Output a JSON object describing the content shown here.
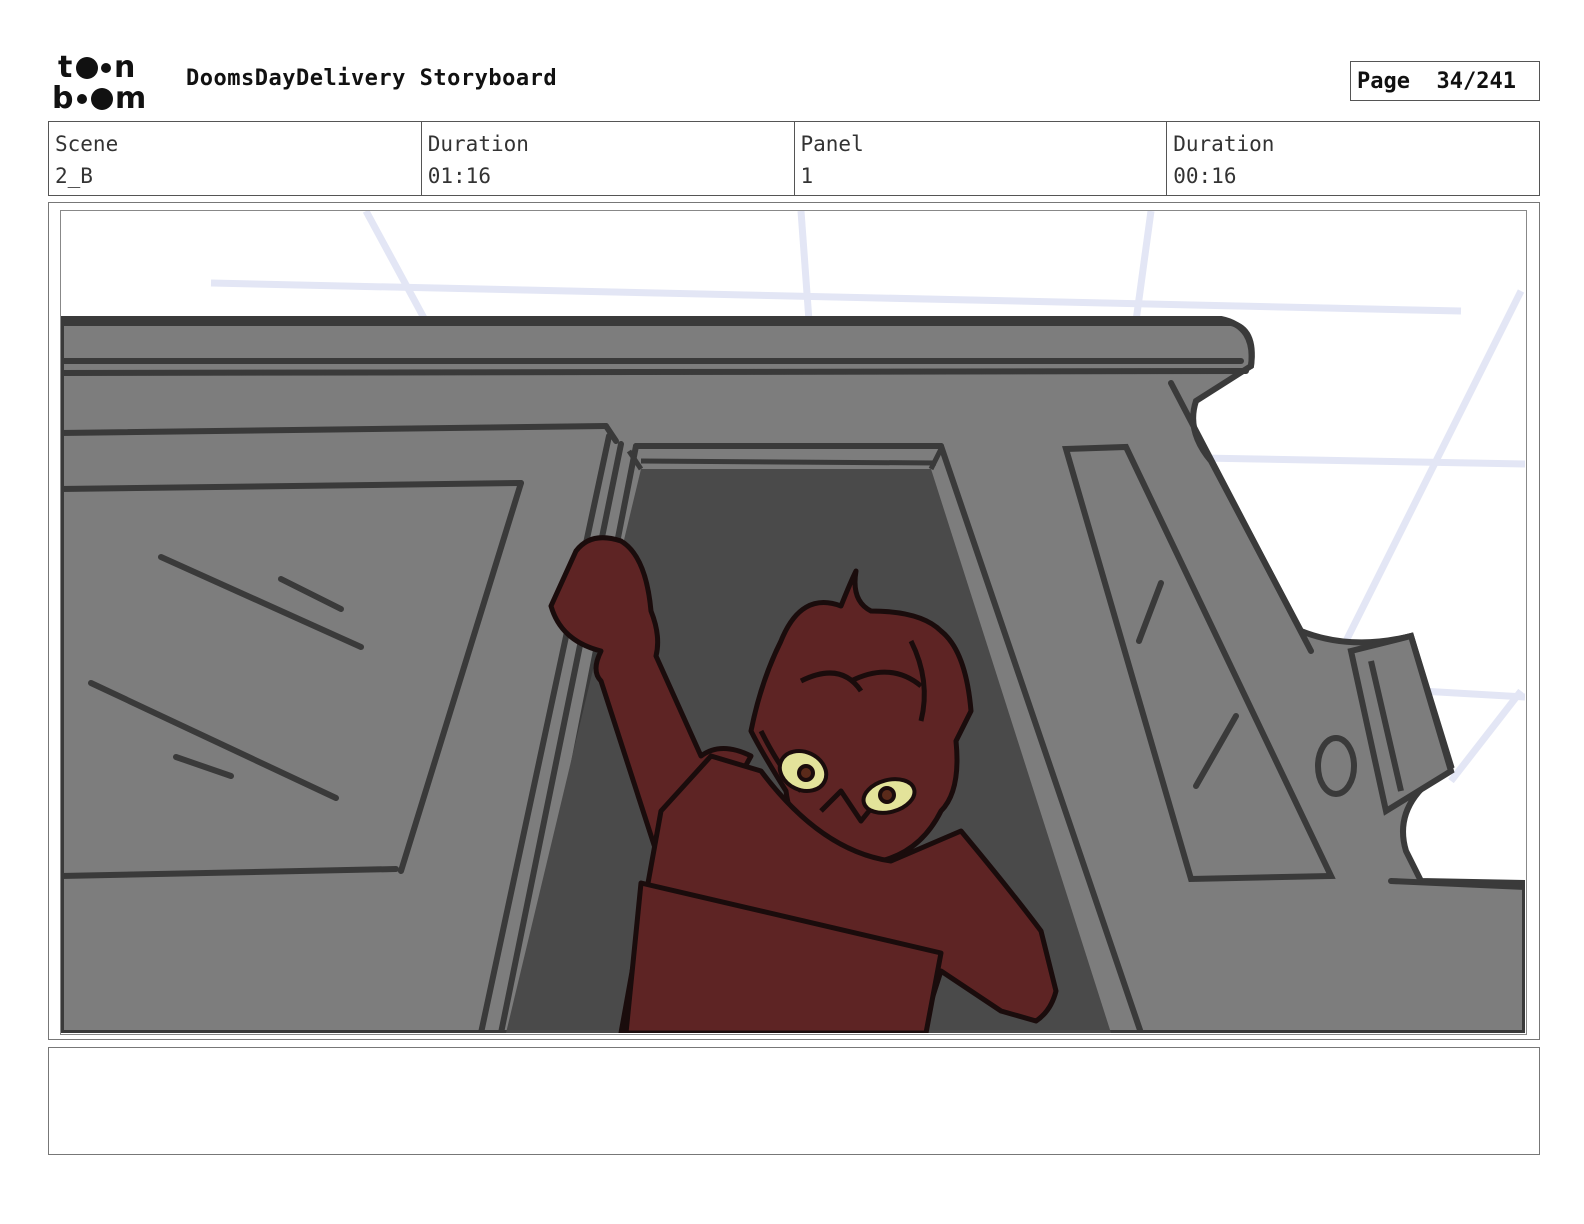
{
  "header": {
    "logo_text": "toonboom",
    "title": "DoomsDayDelivery Storyboard",
    "page_label": "Page",
    "page_value": "34/241"
  },
  "info": {
    "scene_label": "Scene",
    "scene_value": "2_B",
    "scene_duration_label": "Duration",
    "scene_duration_value": "01:16",
    "panel_label": "Panel",
    "panel_value": "1",
    "panel_duration_label": "Duration",
    "panel_duration_value": "00:16"
  },
  "panel_image": {
    "colors": {
      "truck_body": "#7d7d7d",
      "truck_lines": "#3a3a3a",
      "doorway": "#4a4a4a",
      "character": "#5e2424",
      "eyes": "#e3e39a",
      "sky_lines": "#e3e6f5"
    }
  },
  "notes": {
    "text": ""
  }
}
